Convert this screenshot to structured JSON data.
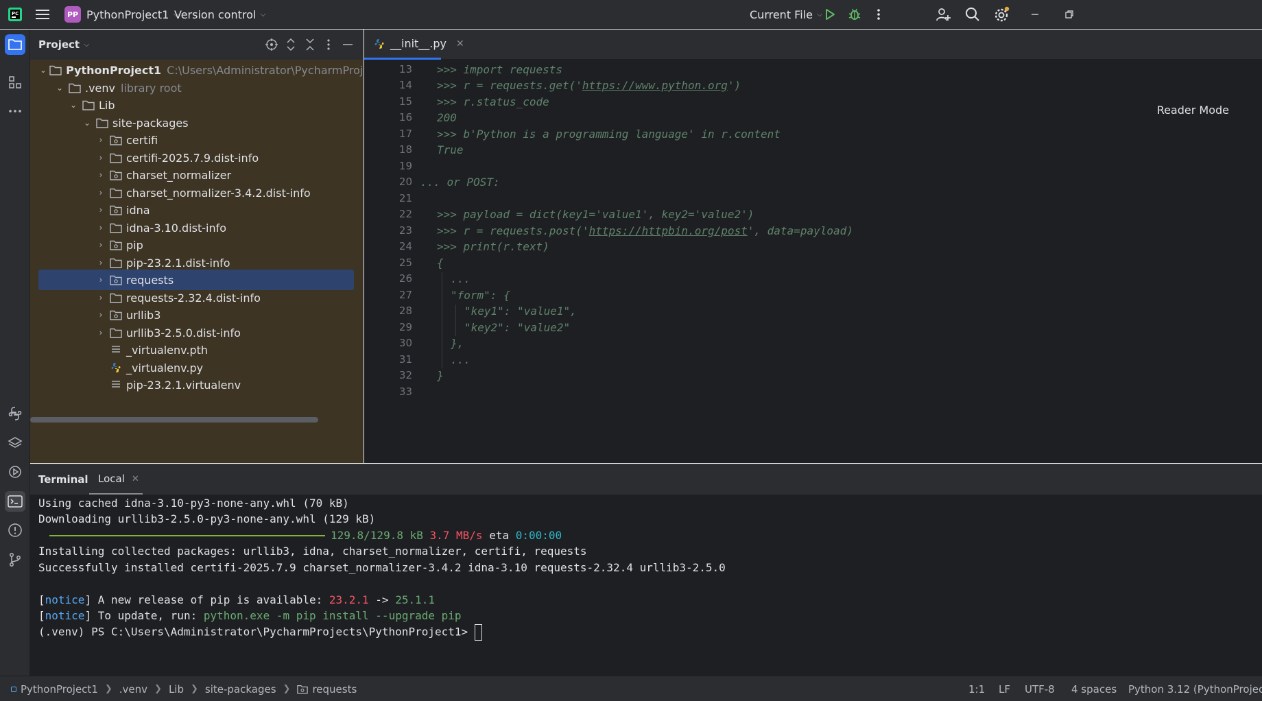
{
  "titlebar": {
    "project_initials": "PP",
    "project_name": "PythonProject1",
    "version_control": "Version control",
    "run_config": "Current File"
  },
  "project_panel": {
    "title": "Project",
    "tree": [
      {
        "label": "PythonProject1",
        "suffix": "C:\\Users\\Administrator\\PycharmProjects\\PythonProj",
        "type": "folder",
        "expanded": true
      },
      {
        "label": ".venv",
        "suffix": "library root",
        "type": "folder",
        "expanded": true
      },
      {
        "label": "Lib",
        "suffix": "",
        "type": "folder",
        "expanded": true
      },
      {
        "label": "site-packages",
        "suffix": "",
        "type": "folder",
        "expanded": true
      },
      {
        "label": "certifi",
        "suffix": "",
        "type": "package"
      },
      {
        "label": "certifi-2025.7.9.dist-info",
        "suffix": "",
        "type": "folder"
      },
      {
        "label": "charset_normalizer",
        "suffix": "",
        "type": "package"
      },
      {
        "label": "charset_normalizer-3.4.2.dist-info",
        "suffix": "",
        "type": "folder"
      },
      {
        "label": "idna",
        "suffix": "",
        "type": "package"
      },
      {
        "label": "idna-3.10.dist-info",
        "suffix": "",
        "type": "folder"
      },
      {
        "label": "pip",
        "suffix": "",
        "type": "package"
      },
      {
        "label": "pip-23.2.1.dist-info",
        "suffix": "",
        "type": "folder"
      },
      {
        "label": "requests",
        "suffix": "",
        "type": "package",
        "selected": true
      },
      {
        "label": "requests-2.32.4.dist-info",
        "suffix": "",
        "type": "folder"
      },
      {
        "label": "urllib3",
        "suffix": "",
        "type": "package"
      },
      {
        "label": "urllib3-2.5.0.dist-info",
        "suffix": "",
        "type": "folder"
      },
      {
        "label": "_virtualenv.pth",
        "suffix": "",
        "type": "text-file"
      },
      {
        "label": "_virtualenv.py",
        "suffix": "",
        "type": "python-file"
      },
      {
        "label": "pip-23.2.1.virtualenv",
        "suffix": "",
        "type": "text-file"
      }
    ]
  },
  "editor": {
    "tab_label": "__init__.py",
    "reader_mode": "Reader Mode",
    "line_numbers": [
      "13",
      "14",
      "15",
      "16",
      "17",
      "18",
      "19",
      "20",
      "21",
      "22",
      "23",
      "24",
      "25",
      "26",
      "27",
      "28",
      "29",
      "30",
      "31",
      "32",
      "33"
    ],
    "lines": {
      "l13": ">>> import requests",
      "l14a": ">>> r = requests.get('",
      "l14url": "https://www.python.org",
      "l14b": "')",
      "l15": ">>> r.status_code",
      "l16": "200",
      "l17": ">>> b'Python is a programming language' in r.content",
      "l18": "True",
      "l19": "",
      "l20": "... or POST:",
      "l21": "",
      "l22": ">>> payload = dict(key1='value1', key2='value2')",
      "l23a": ">>> r = requests.post('",
      "l23url": "https://httpbin.org/post",
      "l23b": "', data=payload)",
      "l24": ">>> print(r.text)",
      "l25": "{",
      "l26": "...",
      "l27": "\"form\": {",
      "l28": "\"key1\": \"value1\",",
      "l29": "\"key2\": \"value2\"",
      "l30": "},",
      "l31": "...",
      "l32": "}",
      "l33": ""
    }
  },
  "terminal": {
    "tab_terminal": "Terminal",
    "tab_local": "Local",
    "line1": "Using cached idna-3.10-py3-none-any.whl (70 kB)",
    "line2": "Downloading urllib3-2.5.0-py3-none-any.whl (129 kB)",
    "progress_size": "129.8/129.8 kB",
    "progress_speed": "3.7 MB/s",
    "progress_eta_label": "eta",
    "progress_eta": "0:00:00",
    "progress_fraction": 1.0,
    "line4": "Installing collected packages: urllib3, idna, charset_normalizer, certifi, requests",
    "line5": "Successfully installed certifi-2025.7.9 charset_normalizer-3.4.2 idna-3.10 requests-2.32.4 urllib3-2.5.0",
    "notice_word": "notice",
    "notice1_text": " A new release of pip is available: ",
    "notice1_old": "23.2.1",
    "notice1_arrow": " -> ",
    "notice1_new": "25.1.1",
    "notice2_text": " To update, run: ",
    "notice2_cmd": "python.exe -m pip install --upgrade pip",
    "prompt": "(.venv) PS C:\\Users\\Administrator\\PycharmProjects\\PythonProject1> "
  },
  "statusbar": {
    "breadcrumbs": [
      "PythonProject1",
      ".venv",
      "Lib",
      "site-packages",
      "requests"
    ],
    "position": "1:1",
    "line_sep": "LF",
    "encoding": "UTF-8",
    "indent": "4 spaces",
    "interpreter": "Python 3.12 (PythonProjec"
  },
  "colors": {
    "accent": "#3574f0",
    "panel_bg": "#2b2d30",
    "editor_bg": "#1e1f22",
    "library_tint": "#3d3424",
    "selection": "#2e436e",
    "string_green": "#6aab73",
    "error_red": "#f75464",
    "cyan": "#2fb8c9"
  }
}
